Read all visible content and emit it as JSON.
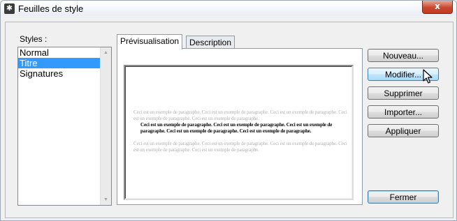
{
  "window": {
    "title": "Feuilles de style",
    "close_glyph": "x"
  },
  "icons": {
    "app": "stylesheet-app-icon",
    "close": "close-icon",
    "scroll_up": "scroll-up-arrow-icon",
    "scroll_down": "scroll-down-arrow-icon",
    "cursor": "mouse-pointer-icon"
  },
  "styles": {
    "label": "Styles :",
    "items": [
      {
        "label": "Normal",
        "selected": false
      },
      {
        "label": "Titre",
        "selected": true
      },
      {
        "label": "Signatures",
        "selected": false
      }
    ]
  },
  "tabs": [
    {
      "label": "Prévisualisation",
      "active": true
    },
    {
      "label": "Description",
      "active": false
    }
  ],
  "preview": {
    "before_text": "Ceci est un exemple de paragraphe. Ceci est un exemple de paragraphe. Ceci est un exemple de paragraphe. Ceci est un exemple de paragraphe. Ceci est un exemple de paragraphe.",
    "sample_text": "Ceci est un exemple de paragraphe. Ceci est un exemple de paragraphe. Ceci est un exemple de paragraphe. Ceci est un exemple de paragraphe. Ceci est un exemple de paragraphe.",
    "after_text": "Ceci est un exemple de paragraphe. Ceci est un exemple de paragraphe. Ceci est un exemple de paragraphe. Ceci est un exemple de paragraphe. Ceci est un exemple de paragraphe."
  },
  "buttons": {
    "new": "Nouveau...",
    "modify": "Modifier...",
    "delete": "Supprimer",
    "import": "Importer...",
    "apply": "Appliquer",
    "close": "Fermer"
  },
  "colors": {
    "selection": "#3399ff",
    "close_button": "#c8482f",
    "hover_border": "#3c7fb1"
  }
}
